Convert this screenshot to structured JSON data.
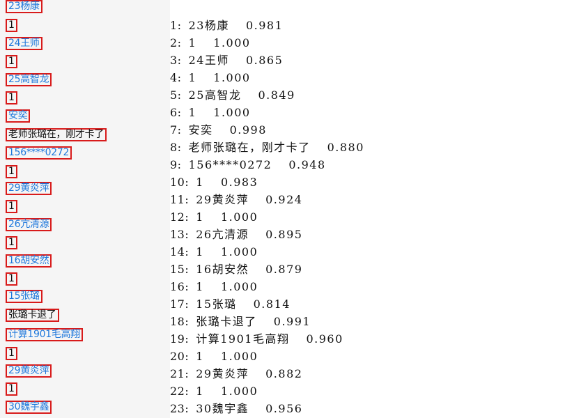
{
  "detections": [
    {
      "text": "23杨康",
      "style": "blue"
    },
    {
      "text": "1",
      "style": "dark"
    },
    {
      "text": "24王师",
      "style": "blue"
    },
    {
      "text": "1",
      "style": "dark"
    },
    {
      "text": "25高智龙",
      "style": "blue"
    },
    {
      "text": "1",
      "style": "dark"
    },
    {
      "text": "安奕",
      "style": "blue"
    },
    {
      "text": "老师张璐在，刚才卡了",
      "style": "dark"
    },
    {
      "text": "156****0272",
      "style": "blue"
    },
    {
      "text": "1",
      "style": "dark"
    },
    {
      "text": "29黄炎萍",
      "style": "blue"
    },
    {
      "text": "1",
      "style": "dark"
    },
    {
      "text": "26亢清源",
      "style": "blue"
    },
    {
      "text": "1",
      "style": "dark"
    },
    {
      "text": "16胡安然",
      "style": "blue"
    },
    {
      "text": "1",
      "style": "dark"
    },
    {
      "text": "15张璐",
      "style": "blue"
    },
    {
      "text": "张璐卡退了",
      "style": "dark"
    },
    {
      "text": "计算1901毛高翔",
      "style": "blue"
    },
    {
      "text": "1",
      "style": "dark"
    },
    {
      "text": "29黄炎萍",
      "style": "blue"
    },
    {
      "text": "1",
      "style": "dark"
    },
    {
      "text": "30魏宇鑫",
      "style": "blue"
    }
  ],
  "results": [
    {
      "idx": "1:",
      "text": "23杨康",
      "score": "0.981"
    },
    {
      "idx": "2:",
      "text": "1",
      "score": "1.000"
    },
    {
      "idx": "3:",
      "text": "24王师",
      "score": "0.865"
    },
    {
      "idx": "4:",
      "text": "1",
      "score": "1.000"
    },
    {
      "idx": "5:",
      "text": "25高智龙",
      "score": "0.849"
    },
    {
      "idx": "6:",
      "text": "1",
      "score": "1.000"
    },
    {
      "idx": "7:",
      "text": "安奕",
      "score": "0.998"
    },
    {
      "idx": "8:",
      "text": "老师张璐在，刚才卡了",
      "score": "0.880"
    },
    {
      "idx": "9:",
      "text": "156****0272",
      "score": "0.948"
    },
    {
      "idx": "10:",
      "text": "1",
      "score": "0.983"
    },
    {
      "idx": "11:",
      "text": "29黄炎萍",
      "score": "0.924"
    },
    {
      "idx": "12:",
      "text": "1",
      "score": "1.000"
    },
    {
      "idx": "13:",
      "text": "26亢清源",
      "score": "0.895"
    },
    {
      "idx": "14:",
      "text": "1",
      "score": "1.000"
    },
    {
      "idx": "15:",
      "text": "16胡安然",
      "score": "0.879"
    },
    {
      "idx": "16:",
      "text": "1",
      "score": "1.000"
    },
    {
      "idx": "17:",
      "text": "15张璐",
      "score": "0.814"
    },
    {
      "idx": "18:",
      "text": "张璐卡退了",
      "score": "0.991"
    },
    {
      "idx": "19:",
      "text": "计算1901毛高翔",
      "score": "0.960"
    },
    {
      "idx": "20:",
      "text": "1",
      "score": "1.000"
    },
    {
      "idx": "21:",
      "text": "29黄炎萍",
      "score": "0.882"
    },
    {
      "idx": "22:",
      "text": "1",
      "score": "1.000"
    },
    {
      "idx": "23:",
      "text": "30魏宇鑫",
      "score": "0.956"
    }
  ]
}
